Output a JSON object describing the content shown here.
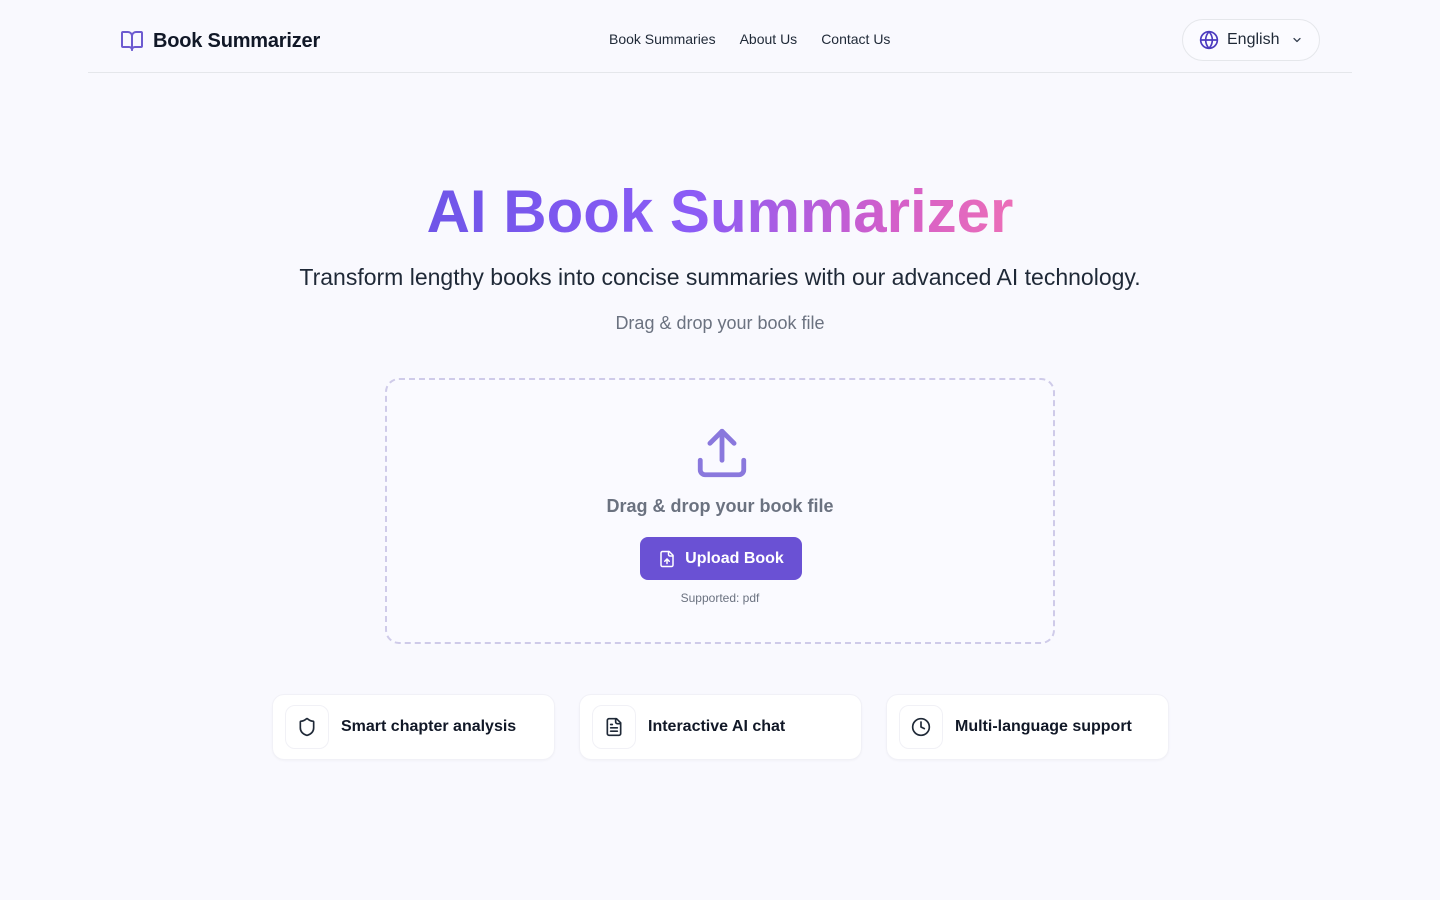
{
  "header": {
    "logo_text": "Book Summarizer",
    "nav": [
      {
        "label": "Book Summaries"
      },
      {
        "label": "About Us"
      },
      {
        "label": "Contact Us"
      }
    ],
    "language": {
      "label": "English",
      "icon": "globe-icon"
    }
  },
  "hero": {
    "title": "AI Book Summarizer",
    "subtitle": "Transform lengthy books into concise summaries with our advanced AI technology.",
    "hint": "Drag & drop your book file"
  },
  "dropzone": {
    "icon": "upload-icon",
    "text": "Drag & drop your book file",
    "button_label": "Upload Book",
    "supported": "Supported: pdf"
  },
  "features": [
    {
      "label": "Smart chapter analysis",
      "icon": "shield-icon"
    },
    {
      "label": "Interactive AI chat",
      "icon": "document-icon"
    },
    {
      "label": "Multi-language support",
      "icon": "clock-icon"
    }
  ],
  "colors": {
    "accent": "#6a51d4",
    "gradient_start": "#6f55e8",
    "gradient_end": "#ec6fb8",
    "background": "#f9f9fe"
  }
}
